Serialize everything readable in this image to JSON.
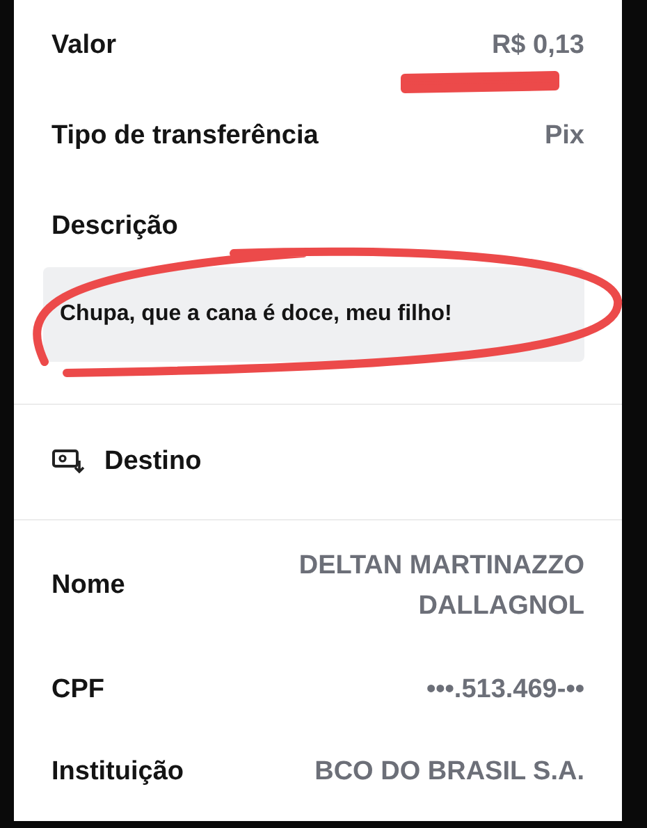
{
  "details": [
    {
      "label": "Valor",
      "value": "R$ 0,13",
      "marked": true
    },
    {
      "label": "Tipo de transferência",
      "value": "Pix",
      "marked": false
    }
  ],
  "description": {
    "label": "Descrição",
    "text": "Chupa, que a cana é doce, meu filho!",
    "marked": true
  },
  "destination": {
    "title": "Destino",
    "rows": [
      {
        "label": "Nome",
        "value": "DELTAN MARTINAZZO DALLAGNOL"
      },
      {
        "label": "CPF",
        "value": "•••.513.469-••"
      },
      {
        "label": "Instituição",
        "value": "BCO DO BRASIL S.A."
      }
    ]
  }
}
